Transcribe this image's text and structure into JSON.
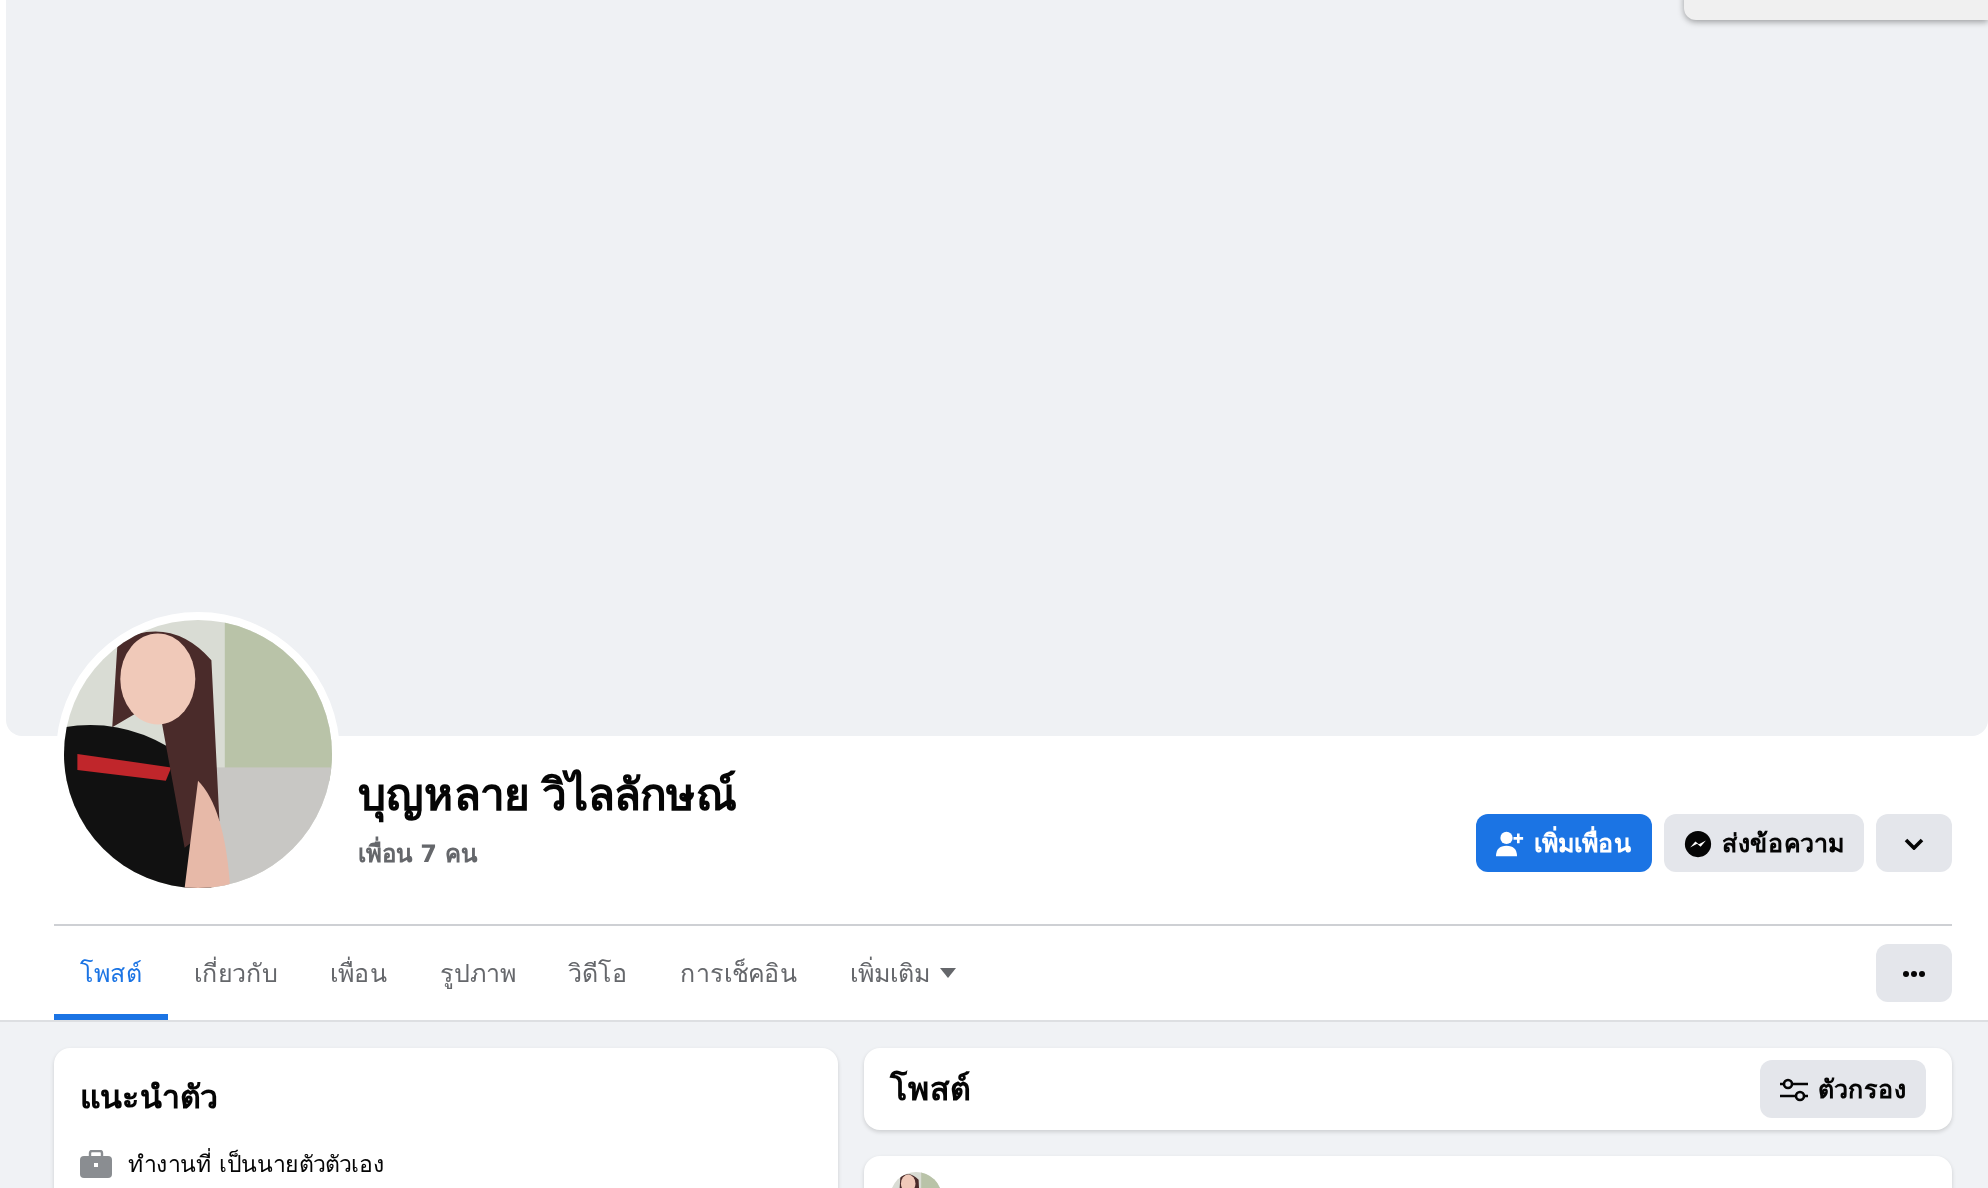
{
  "profile": {
    "name": "บุญหลาย วิไลลักษณ์",
    "friends": "เพื่อน 7 คน"
  },
  "actions": [
    {
      "kind": "add",
      "label": "เพิ่มเพื่อน"
    },
    {
      "kind": "message",
      "label": "ส่งข้อความ"
    },
    {
      "kind": "dropdown"
    }
  ],
  "tabs": [
    {
      "label": "โพสต์",
      "selected": true,
      "dropdown": false
    },
    {
      "label": "เกี่ยวกับ",
      "selected": false,
      "dropdown": false
    },
    {
      "label": "เพื่อน",
      "selected": false,
      "dropdown": false
    },
    {
      "label": "รูปภาพ",
      "selected": false,
      "dropdown": false
    },
    {
      "label": "วิดีโอ",
      "selected": false,
      "dropdown": false
    },
    {
      "label": "การเช็คอิน",
      "selected": false,
      "dropdown": false
    },
    {
      "label": "เพิ่มเติม",
      "selected": false,
      "dropdown": true
    }
  ],
  "intro": {
    "title": "แนะนำตัว",
    "items": [
      {
        "text": "ทำงานที่ เป็นนายตัวตัวเอง"
      }
    ]
  },
  "posts": {
    "title": "โพสต์",
    "filter": "ตัวกรอง"
  }
}
